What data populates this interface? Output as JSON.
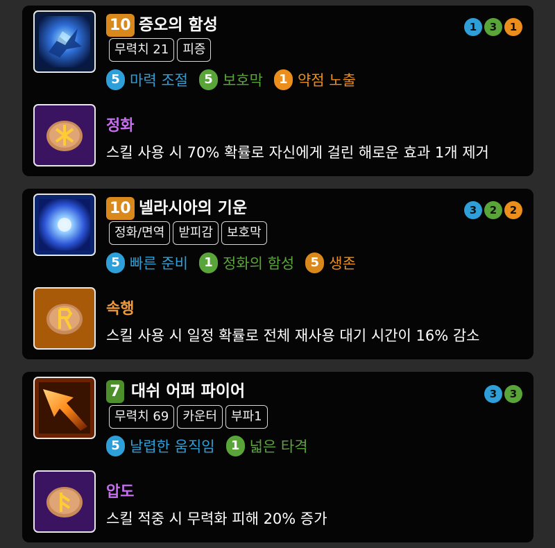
{
  "colors": {
    "blue": "#2e9fd8",
    "green": "#5aa53a",
    "orange": "#ec8e1c",
    "level_orange": "#d9881b",
    "level_green": "#4d8f2a",
    "purple": "#c76ef0",
    "rune_orange": "#f09a3c"
  },
  "skills": [
    {
      "icon": "ice-claw-skill-icon",
      "level": "10",
      "name": "증오의 함성",
      "tags": [
        "무력치 21",
        "피증"
      ],
      "gems": [
        "1",
        "3",
        "1"
      ],
      "tripods": [
        {
          "num": "5",
          "name": "마력 조절",
          "tier": "blue"
        },
        {
          "num": "5",
          "name": "보호막",
          "tier": "green"
        },
        {
          "num": "1",
          "name": "약점 노출",
          "tier": "orange"
        }
      ],
      "rune": {
        "icon": "purple-rune-icon",
        "name": "정화",
        "desc": "스킬 사용 시 70% 확률로 자신에게 걸린 해로운 효과 1개 제거"
      }
    },
    {
      "icon": "blue-orb-skill-icon",
      "level": "10",
      "name": "넬라시아의 기운",
      "tags": [
        "정화/면역",
        "받피감",
        "보호막"
      ],
      "gems": [
        "3",
        "2",
        "2"
      ],
      "tripods": [
        {
          "num": "5",
          "name": "빠른 준비",
          "tier": "blue"
        },
        {
          "num": "1",
          "name": "정화의 함성",
          "tier": "green"
        },
        {
          "num": "5",
          "name": "생존",
          "tier": "orange"
        }
      ],
      "rune": {
        "icon": "orange-rune-icon",
        "name": "속행",
        "desc": "스킬 사용 시 일정 확률로 전체 재사용 대기 시간이 16% 감소"
      }
    },
    {
      "icon": "fire-dash-skill-icon",
      "level": "7",
      "name": "대쉬 어퍼 파이어",
      "tags": [
        "무력치 69",
        "카운터",
        "부파1"
      ],
      "gems": [
        "3",
        "3"
      ],
      "tripods": [
        {
          "num": "5",
          "name": "날렵한 움직임",
          "tier": "blue"
        },
        {
          "num": "1",
          "name": "넓은 타격",
          "tier": "green"
        }
      ],
      "rune": {
        "icon": "purple-rune-icon",
        "name": "압도",
        "desc": "스킬 적중 시 무력화 피해 20% 증가"
      }
    }
  ]
}
